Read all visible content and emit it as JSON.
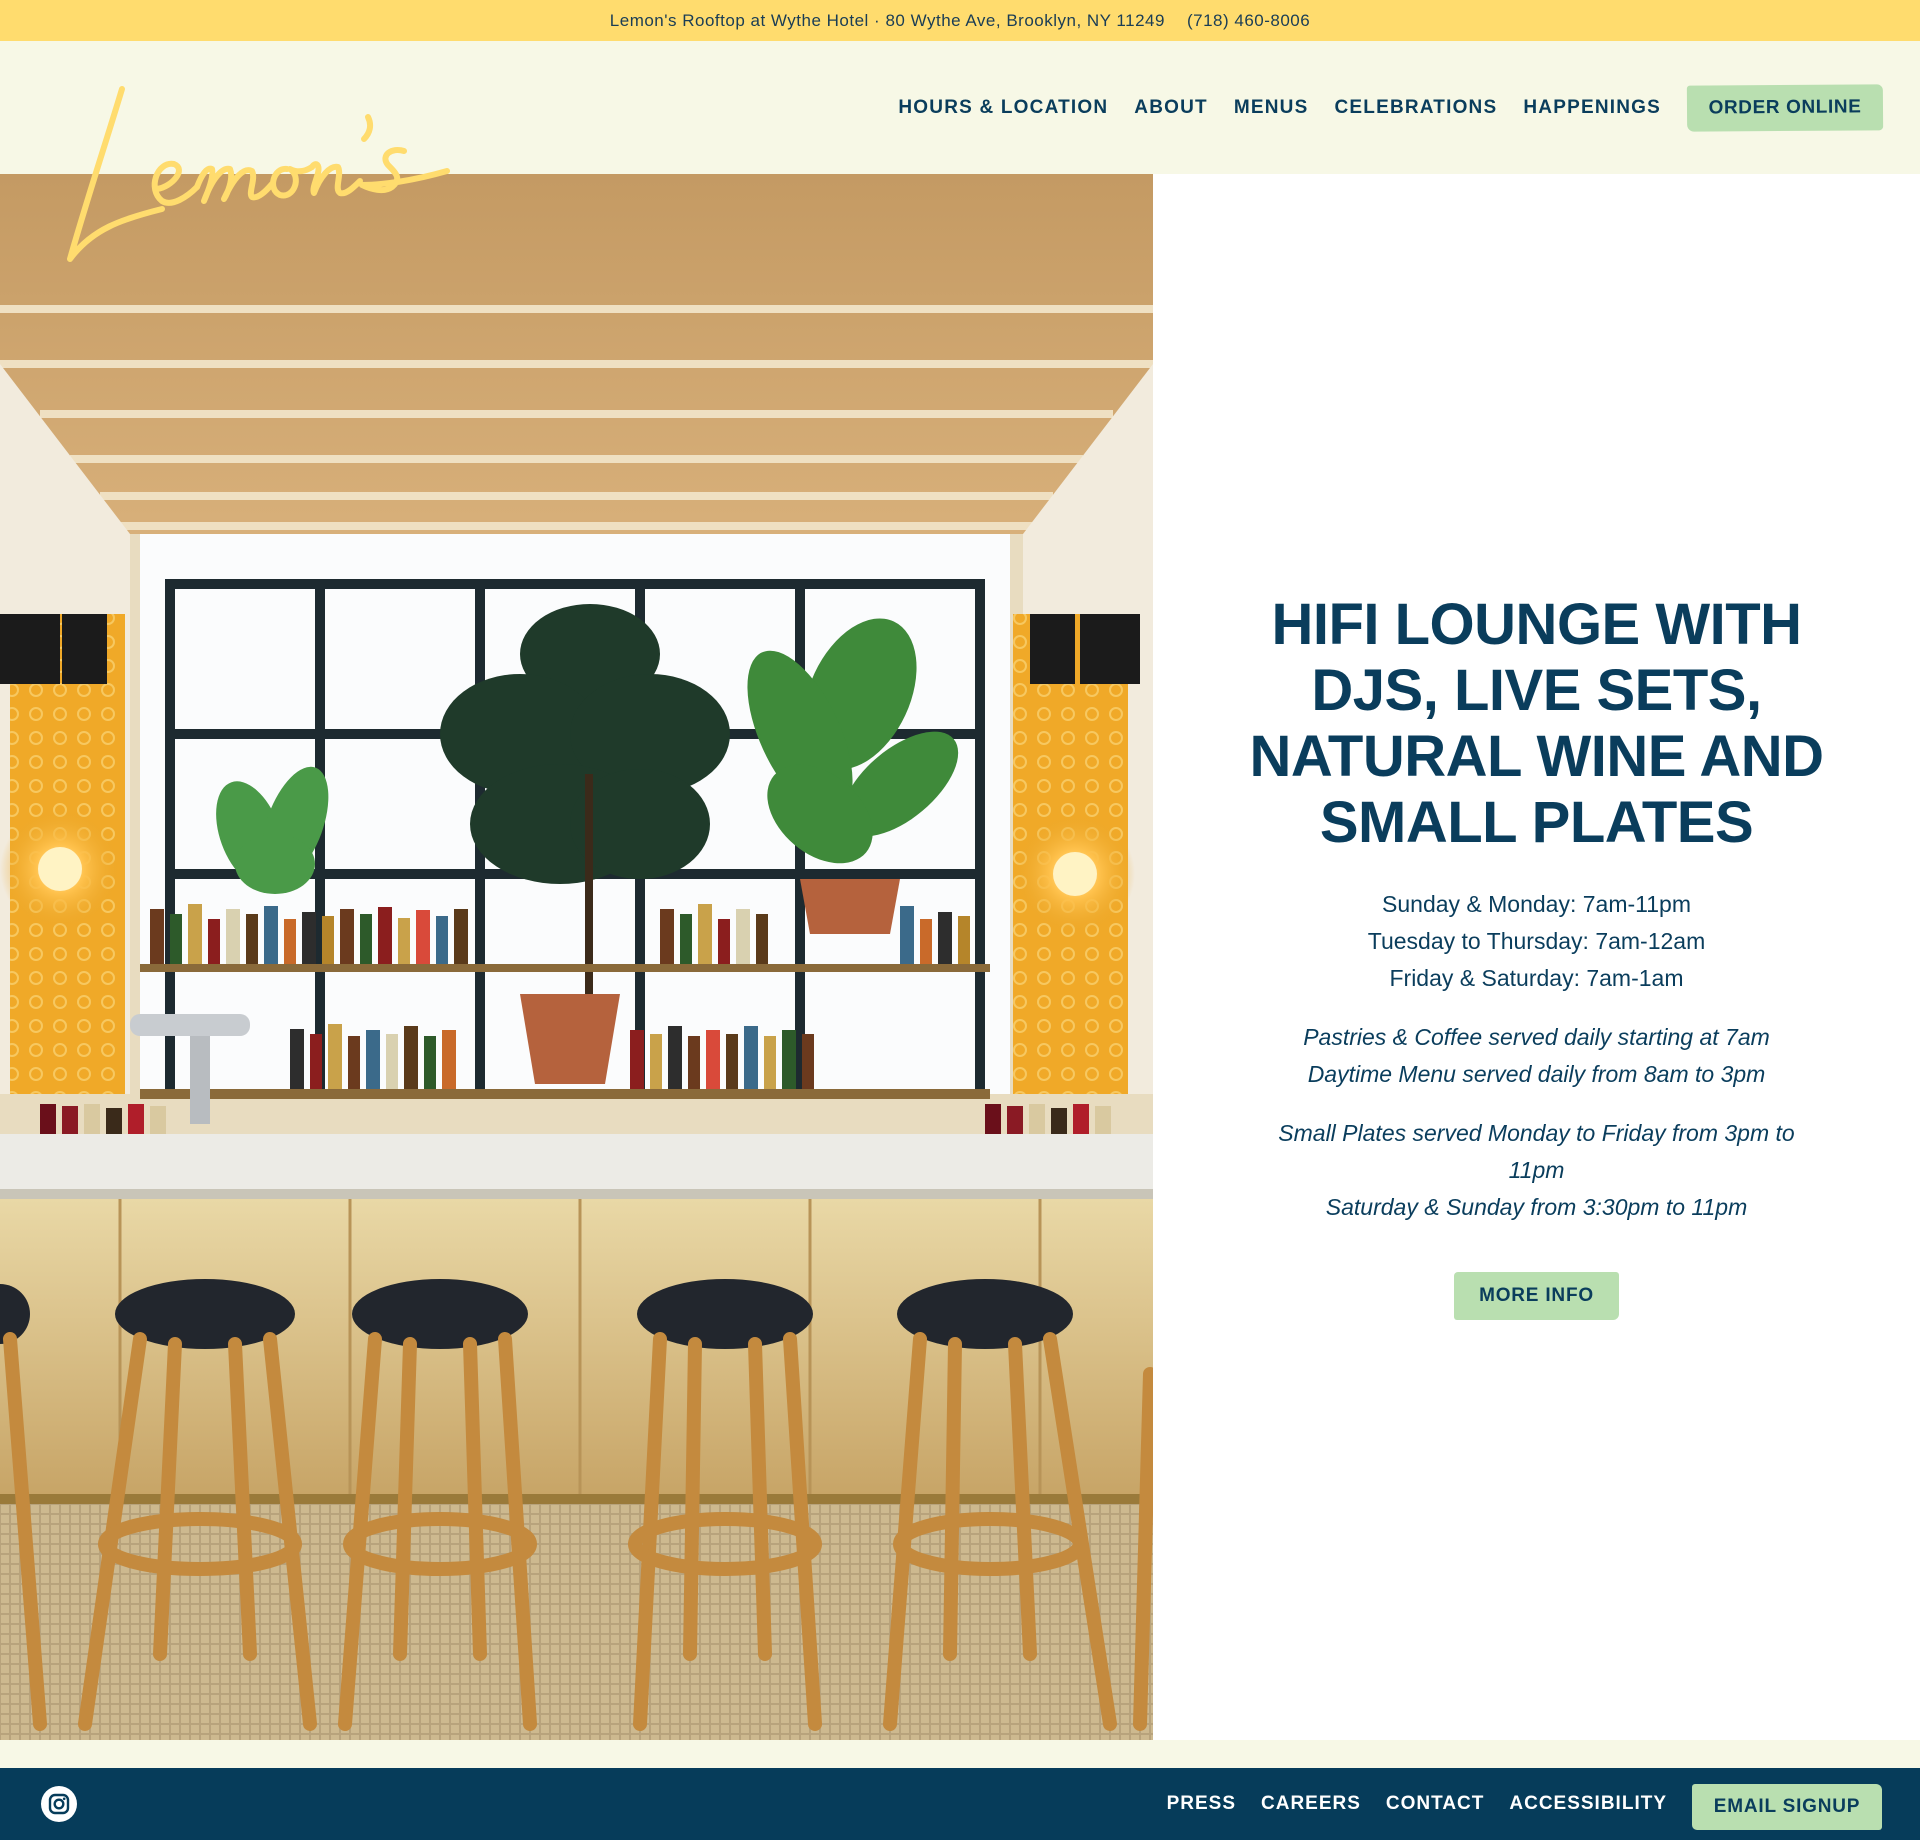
{
  "topbar": {
    "address": "Lemon's Rooftop at Wythe Hotel · 80 Wythe Ave, Brooklyn, NY 11249",
    "phone": "(718) 460-8006"
  },
  "brand": {
    "logo_text": "Lemon's",
    "logo_color": "#ffdc6e"
  },
  "nav": {
    "items": [
      {
        "label": "HOURS & LOCATION"
      },
      {
        "label": "ABOUT"
      },
      {
        "label": "MENUS"
      },
      {
        "label": "CELEBRATIONS"
      },
      {
        "label": "HAPPENINGS"
      }
    ],
    "order_label": "ORDER ONLINE"
  },
  "hero": {
    "image_alt": "Bar interior with rattan stools, plants and liquor shelves"
  },
  "info": {
    "headline": "HIFI LOUNGE WITH DJS, LIVE SETS, NATURAL WINE AND SMALL PLATES",
    "hours": [
      "Sunday & Monday: 7am-11pm",
      "Tuesday to Thursday: 7am-12am",
      "Friday & Saturday: 7am-1am"
    ],
    "notes_a": [
      "Pastries & Coffee served daily starting at 7am",
      "Daytime Menu served daily from 8am to 3pm"
    ],
    "notes_b": [
      "Small Plates served Monday to Friday from 3pm to 11pm",
      "Saturday & Sunday from 3:30pm to 11pm"
    ],
    "button_label": "MORE INFO"
  },
  "footer": {
    "links": [
      {
        "label": "PRESS"
      },
      {
        "label": "CAREERS"
      },
      {
        "label": "CONTACT"
      },
      {
        "label": "ACCESSIBILITY"
      }
    ],
    "email_label": "EMAIL SIGNUP",
    "social_icon": "instagram-icon"
  },
  "colors": {
    "topbar": "#ffdc6e",
    "header_bg": "#f7f8e6",
    "navy": "#0a3d5c",
    "button_green": "#b9dfb0",
    "footer_bg": "#063c5a"
  }
}
